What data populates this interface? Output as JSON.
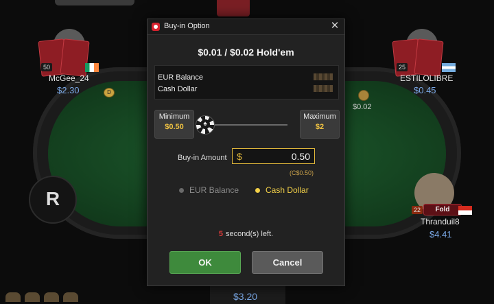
{
  "table": {
    "pot_amount": "$0.02",
    "reserve_button_label": "R",
    "bottom_player_stack": "$3.20"
  },
  "seats": {
    "left": {
      "name": "McGee_24",
      "stack": "$2.30",
      "level": "50"
    },
    "right": {
      "name": "ESTILOLIBRE",
      "stack": "$0.45",
      "level": "25"
    },
    "bottom_right": {
      "name": "Thranduil8",
      "stack": "$4.41",
      "level": "22",
      "status": "Fold"
    }
  },
  "dialog": {
    "title": "Buy-in Option",
    "close_icon": "close-icon",
    "game_title": "$0.01 / $0.02 Hold'em",
    "balances": [
      {
        "label": "EUR Balance"
      },
      {
        "label": "Cash Dollar"
      }
    ],
    "minimum": {
      "label": "Minimum",
      "value": "$0.50"
    },
    "maximum": {
      "label": "Maximum",
      "value": "$2"
    },
    "slider_fraction": 0,
    "buyin": {
      "label": "Buy-in Amount",
      "currency": "$",
      "value": "0.50",
      "converted": "(C$0.50)"
    },
    "payment_options": [
      {
        "label": "EUR Balance",
        "selected": false
      },
      {
        "label": "Cash Dollar",
        "selected": true
      }
    ],
    "countdown": {
      "number": "5",
      "text": "second(s) left."
    },
    "ok_label": "OK",
    "cancel_label": "Cancel"
  },
  "colors": {
    "accent_gold": "#e0b73b",
    "ok_green": "#3e8a3c",
    "felt_green": "#174a24",
    "card_red": "#8e1d24"
  }
}
